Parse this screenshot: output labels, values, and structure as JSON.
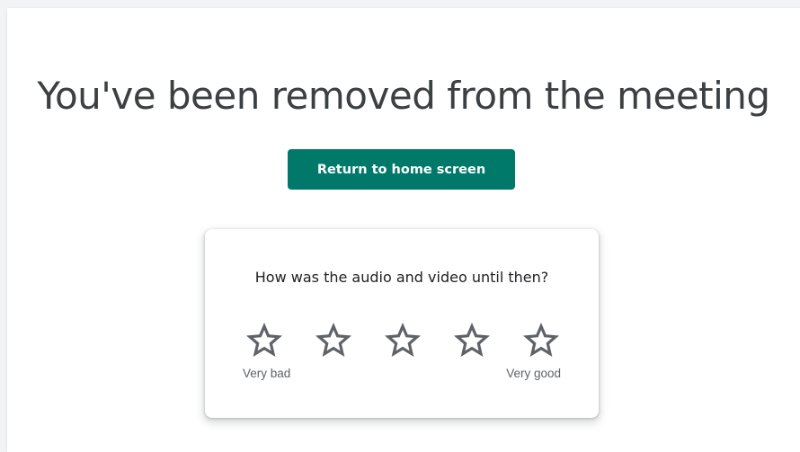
{
  "message": {
    "title": "You've been removed from the meeting"
  },
  "actions": {
    "return_label": "Return to home screen"
  },
  "feedback": {
    "question": "How was the audio and video until then?",
    "rating_max": 5,
    "rating_value": 0,
    "stars": [
      {
        "icon": "star-outline-icon"
      },
      {
        "icon": "star-outline-icon"
      },
      {
        "icon": "star-outline-icon"
      },
      {
        "icon": "star-outline-icon"
      },
      {
        "icon": "star-outline-icon"
      }
    ],
    "low_label": "Very bad",
    "high_label": "Very good"
  },
  "colors": {
    "primary_button": "#00796b",
    "title_text": "#3c4043",
    "star_outline": "#5f6368",
    "secondary_text": "#5f6368",
    "background": "#f1f3f4"
  }
}
